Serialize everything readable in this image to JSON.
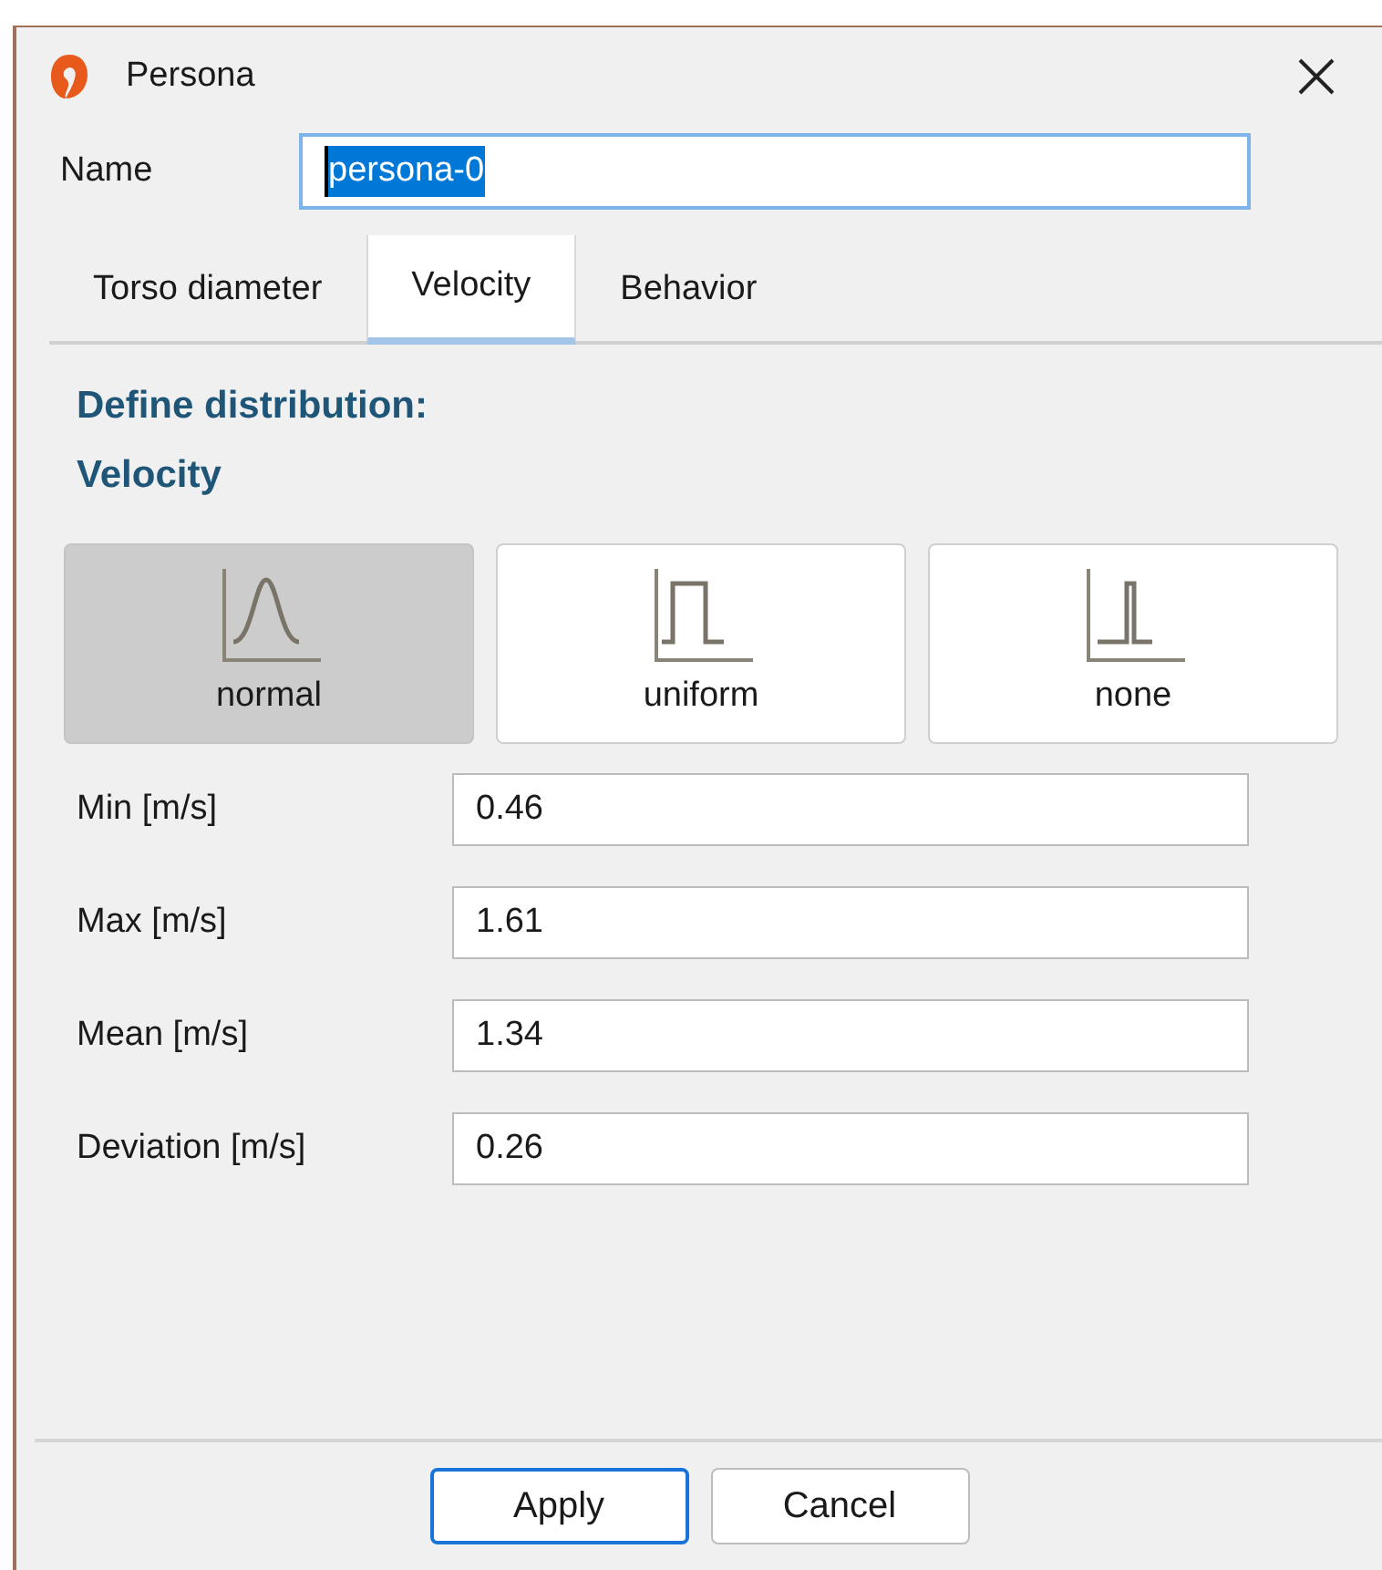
{
  "window": {
    "title": "Persona"
  },
  "name_field": {
    "label": "Name",
    "value": "persona-0",
    "text_selected": true
  },
  "tabs": [
    {
      "label": "Torso diameter",
      "selected": false
    },
    {
      "label": "Velocity",
      "selected": true
    },
    {
      "label": "Behavior",
      "selected": false
    }
  ],
  "heading": [
    "Define distribution:",
    "Velocity"
  ],
  "distributions": [
    {
      "kind": "normal",
      "label": "normal",
      "selected": true
    },
    {
      "kind": "uniform",
      "label": "uniform",
      "selected": false
    },
    {
      "kind": "none",
      "label": "none",
      "selected": false
    }
  ],
  "fields": [
    {
      "label": "Min [m/s]",
      "value": "0.46"
    },
    {
      "label": "Max [m/s]",
      "value": "1.61"
    },
    {
      "label": "Mean [m/s]",
      "value": "1.34"
    },
    {
      "label": "Deviation [m/s]",
      "value": "0.26"
    }
  ],
  "buttons": [
    {
      "label": "Apply",
      "default": true
    },
    {
      "label": "Cancel",
      "default": false
    }
  ]
}
